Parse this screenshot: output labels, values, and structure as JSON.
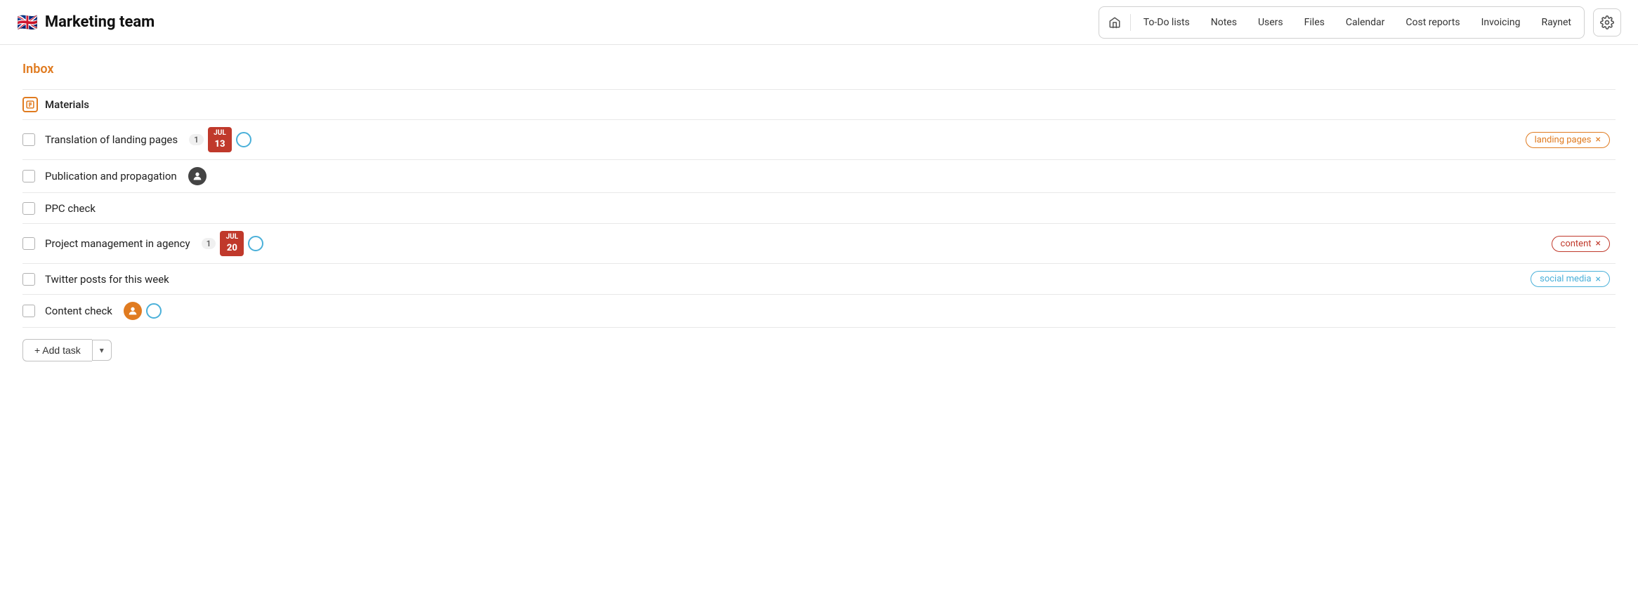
{
  "header": {
    "brand": "Marketing team",
    "flag": "🇬🇧",
    "nav": {
      "home_icon": "🏠",
      "items": [
        {
          "id": "to-do-lists",
          "label": "To-Do lists"
        },
        {
          "id": "notes",
          "label": "Notes"
        },
        {
          "id": "users",
          "label": "Users"
        },
        {
          "id": "files",
          "label": "Files"
        },
        {
          "id": "calendar",
          "label": "Calendar"
        },
        {
          "id": "cost-reports",
          "label": "Cost reports"
        },
        {
          "id": "invoicing",
          "label": "Invoicing"
        },
        {
          "id": "raynet",
          "label": "Raynet"
        }
      ]
    },
    "gear_label": "⚙"
  },
  "main": {
    "inbox_title": "Inbox",
    "section_label": "Materials",
    "tasks": [
      {
        "id": "task-1",
        "name": "Translation of landing pages",
        "badge_count": "1",
        "has_date": true,
        "date_month": "Jul",
        "date_day": "13",
        "has_circle": true,
        "tag": "landing pages",
        "tag_style": "orange"
      },
      {
        "id": "task-2",
        "name": "Publication and propagation",
        "has_avatar": true,
        "avatar_type": "dark",
        "tag": null
      },
      {
        "id": "task-3",
        "name": "PPC check",
        "tag": null
      },
      {
        "id": "task-4",
        "name": "Project management in agency",
        "badge_count": "1",
        "has_date": true,
        "date_month": "Jul",
        "date_day": "20",
        "has_circle": true,
        "tag": "content",
        "tag_style": "red"
      },
      {
        "id": "task-5",
        "name": "Twitter posts for this week",
        "tag": "social media",
        "tag_style": "blue"
      },
      {
        "id": "task-6",
        "name": "Content check",
        "has_avatar": true,
        "avatar_type": "color",
        "has_circle": true,
        "tag": null
      }
    ],
    "add_task_label": "+ Add task",
    "dropdown_arrow": "▾"
  }
}
